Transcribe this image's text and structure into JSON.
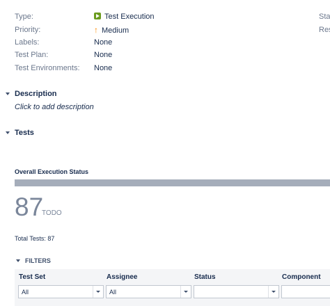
{
  "details": {
    "rows": [
      {
        "label": "Type:",
        "value": "Test Execution"
      },
      {
        "label": "Priority:",
        "value": "Medium"
      },
      {
        "label": "Labels:",
        "value": "None"
      },
      {
        "label": "Test Plan:",
        "value": "None"
      },
      {
        "label": "Test Environments:",
        "value": "None"
      }
    ],
    "right_col": [
      "Stat",
      "Res"
    ]
  },
  "description": {
    "heading": "Description",
    "placeholder": "Click to add description"
  },
  "tests": {
    "heading": "Tests",
    "overall_label": "Overall Execution Status",
    "progress_todo_fraction": 1.0,
    "todo_count": "87",
    "todo_label": "TODO",
    "total_tests": "Total Tests: 87"
  },
  "filters": {
    "toggle_label": "FILTERS",
    "columns": [
      {
        "header": "Test Set",
        "value": "All"
      },
      {
        "header": "Assignee",
        "value": "All"
      },
      {
        "header": "Status",
        "value": ""
      },
      {
        "header": "Component",
        "value": ""
      }
    ]
  },
  "colors": {
    "todo_bar": "#a5adba",
    "type_icon": "#6b9b1e",
    "priority_icon": "#ff8b00"
  },
  "icons": {
    "type": "test-execution-icon",
    "priority": "priority-medium-arrow-icon",
    "toggle": "chevron-down-icon",
    "select": "dropdown-arrow-icon"
  }
}
